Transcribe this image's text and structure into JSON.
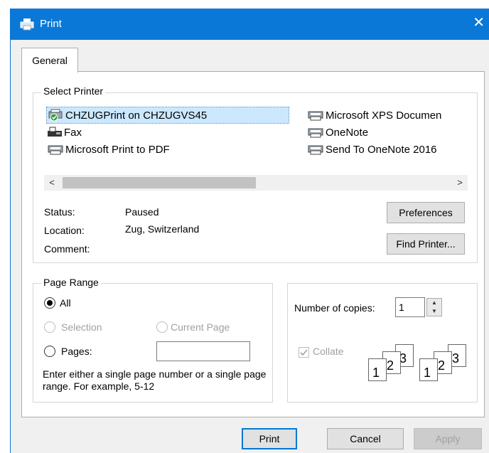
{
  "window": {
    "title": "Print",
    "close_glyph": "✕"
  },
  "tabs": [
    {
      "label": "General"
    }
  ],
  "select_printer": {
    "legend": "Select Printer",
    "printers": [
      {
        "name": "CHZUGPrint on CHZUGVS45",
        "icon": "default-printer-icon",
        "selected": true
      },
      {
        "name": "Fax",
        "icon": "fax-icon"
      },
      {
        "name": "Microsoft Print to PDF",
        "icon": "printer-icon"
      },
      {
        "name": "Microsoft XPS Documen",
        "icon": "printer-icon"
      },
      {
        "name": "OneNote",
        "icon": "printer-icon"
      },
      {
        "name": "Send To OneNote 2016",
        "icon": "printer-icon"
      }
    ],
    "scroll_left": "<",
    "scroll_right": ">",
    "status_label": "Status:",
    "status_value": "Paused",
    "location_label": "Location:",
    "location_value": "Zug, Switzerland",
    "comment_label": "Comment:",
    "comment_value": "",
    "preferences_button": "Preferences",
    "find_printer_button": "Find Printer..."
  },
  "page_range": {
    "legend": "Page Range",
    "all": "All",
    "selection": "Selection",
    "current_page": "Current Page",
    "pages": "Pages:",
    "pages_value": "",
    "hint": "Enter either a single page number or a single page range.  For example, 5-12",
    "selected_option": "all"
  },
  "copies": {
    "number_label": "Number of copies:",
    "number_value": "1",
    "collate_label": "Collate",
    "collate_checked": true,
    "collate_disabled": true,
    "collated_pages": [
      "1",
      "2",
      "3"
    ],
    "uncollated_pages": [
      "1",
      "2",
      "3"
    ]
  },
  "buttons": {
    "print": "Print",
    "cancel": "Cancel",
    "apply": "Apply"
  },
  "colors": {
    "titlebar": "#0a78d7",
    "selection": "#cce8ff",
    "dialog_bg": "#f0f0f0"
  }
}
